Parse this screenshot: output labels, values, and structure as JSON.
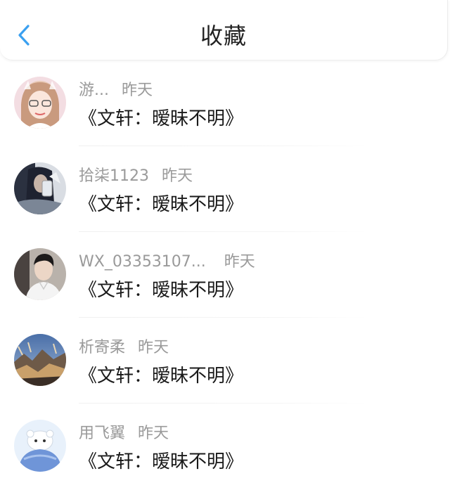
{
  "header": {
    "title": "收藏",
    "accent_color": "#3aa0f0"
  },
  "favorites": [
    {
      "user": "游...",
      "time": "昨天",
      "title": "《文轩：暧昧不明》",
      "avatar": "girl-avatar"
    },
    {
      "user": "拾柒1123",
      "time": "昨天",
      "title": "《文轩：暧昧不明》",
      "avatar": "selfie-avatar"
    },
    {
      "user": "WX_03353107...",
      "time": "昨天",
      "title": "《文轩：暧昧不明》",
      "avatar": "boy-avatar"
    },
    {
      "user": "析寄柔",
      "time": "昨天",
      "title": "《文轩：暧昧不明》",
      "avatar": "landscape-avatar"
    },
    {
      "user": "用飞翼",
      "time": "昨天",
      "title": "《文轩：暧昧不明》",
      "avatar": "cartoon-avatar"
    }
  ]
}
